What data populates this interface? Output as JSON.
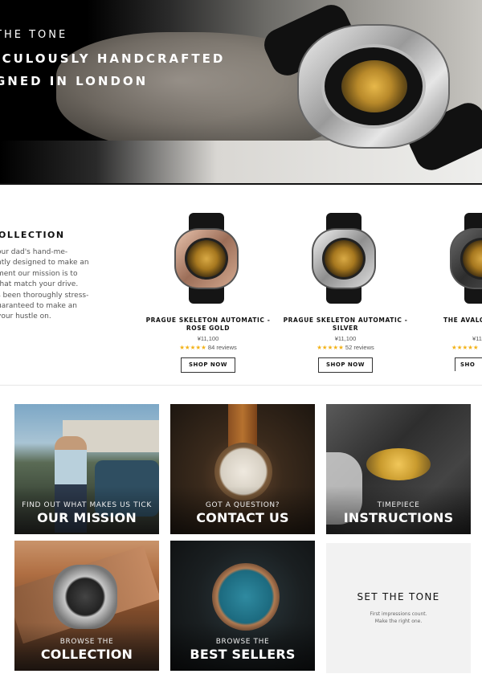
{
  "hero": {
    "line1": "THE TONE",
    "line2": "ICULOUSLY HANDCRAFTED",
    "line3": "GNED IN LONDON"
  },
  "collection": {
    "title": "OLLECTION",
    "description_lines": [
      "our dad's hand-me-",
      "ntly designed to make an",
      "ment our mission is to",
      "that match your drive.",
      "s been thoroughly stress-",
      "uaranteed to make an",
      "your hustle on."
    ]
  },
  "products": [
    {
      "name": "PRAGUE SKELETON AUTOMATIC - ROSE GOLD",
      "price": "¥11,100",
      "stars": "★★★★★",
      "reviews": "84 reviews",
      "button": "SHOP NOW",
      "case_color": "#c79a82"
    },
    {
      "name": "PRAGUE SKELETON AUTOMATIC - SILVER",
      "price": "¥11,100",
      "stars": "★★★★★",
      "reviews": "52 reviews",
      "button": "SHOP NOW",
      "case_color": "#c8c8c8"
    },
    {
      "name": "THE AVALO",
      "price": "¥11",
      "stars": "★★★★★",
      "reviews": "",
      "button": "SHO",
      "case_color": "#4a4a4a"
    }
  ],
  "tiles": {
    "mission": {
      "caption_small": "FIND OUT WHAT MAKES US TICK",
      "caption_big": "OUR MISSION"
    },
    "contact": {
      "caption_small": "GOT A QUESTION?",
      "caption_big": "CONTACT US"
    },
    "instructions": {
      "caption_small": "TIMEPIECE",
      "caption_big": "INSTRUCTIONS"
    },
    "collection": {
      "caption_small": "BROWSE THE",
      "caption_big": "COLLECTION"
    },
    "best_sellers": {
      "caption_small": "BROWSE THE",
      "caption_big": "BEST SELLERS"
    },
    "set_the_tone": {
      "title": "SET THE TONE",
      "sub1": "First impressions count.",
      "sub2": "Make the right one."
    }
  },
  "colors": {
    "star": "#f3b31a",
    "text": "#111111",
    "muted": "#555555"
  }
}
